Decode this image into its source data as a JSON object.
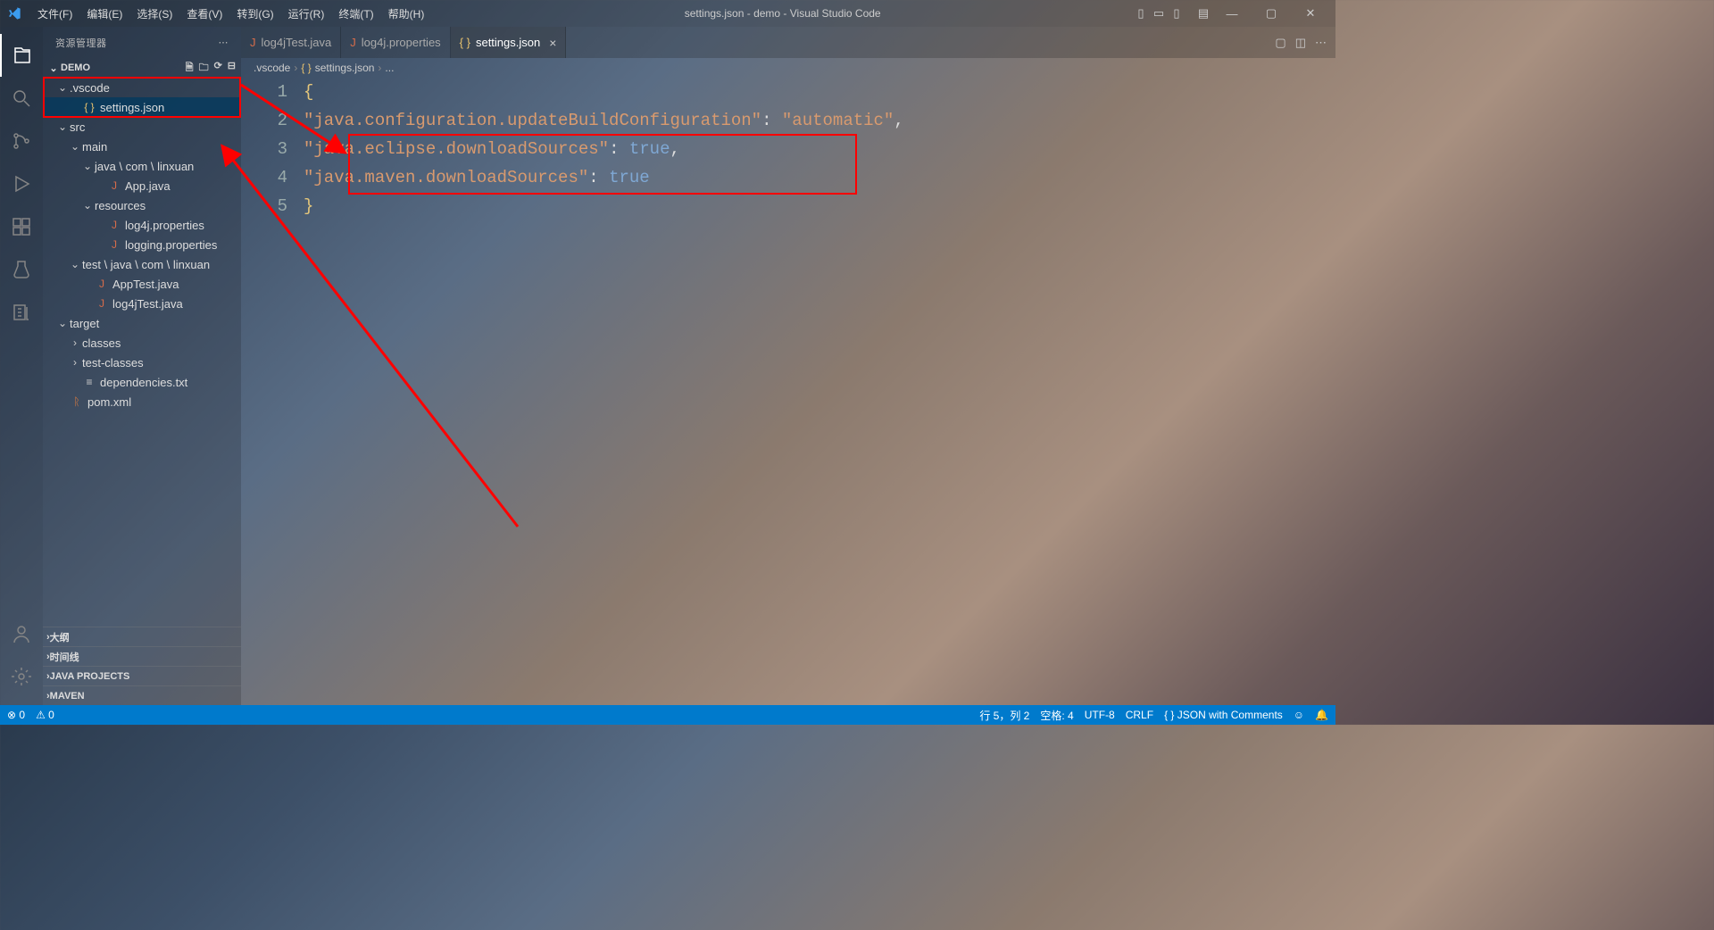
{
  "titlebar": {
    "menu": [
      "文件(F)",
      "编辑(E)",
      "选择(S)",
      "查看(V)",
      "转到(G)",
      "运行(R)",
      "终端(T)",
      "帮助(H)"
    ],
    "title": "settings.json - demo - Visual Studio Code"
  },
  "activitybar": {
    "items": [
      "explorer",
      "search",
      "source-control",
      "run-debug",
      "extensions",
      "testing",
      "references"
    ],
    "bottom": [
      "account",
      "manage"
    ]
  },
  "sidebar": {
    "title": "资源管理器",
    "root": "DEMO",
    "tree": [
      {
        "type": "folder",
        "name": ".vscode",
        "depth": 1,
        "open": true,
        "highlight": true
      },
      {
        "type": "file",
        "name": "settings.json",
        "depth": 2,
        "icon": "braces",
        "selected": true
      },
      {
        "type": "folder",
        "name": "src",
        "depth": 1,
        "open": true
      },
      {
        "type": "folder",
        "name": "main",
        "depth": 2,
        "open": true
      },
      {
        "type": "folder",
        "name": "java \\ com \\ linxuan",
        "depth": 3,
        "open": true
      },
      {
        "type": "file",
        "name": "App.java",
        "depth": 4,
        "icon": "java"
      },
      {
        "type": "folder",
        "name": "resources",
        "depth": 3,
        "open": true
      },
      {
        "type": "file",
        "name": "log4j.properties",
        "depth": 4,
        "icon": "java"
      },
      {
        "type": "file",
        "name": "logging.properties",
        "depth": 4,
        "icon": "java"
      },
      {
        "type": "folder",
        "name": "test \\ java \\ com \\ linxuan",
        "depth": 2,
        "open": true
      },
      {
        "type": "file",
        "name": "AppTest.java",
        "depth": 3,
        "icon": "java"
      },
      {
        "type": "file",
        "name": "log4jTest.java",
        "depth": 3,
        "icon": "java"
      },
      {
        "type": "folder",
        "name": "target",
        "depth": 1,
        "open": true
      },
      {
        "type": "folder",
        "name": "classes",
        "depth": 2,
        "open": false
      },
      {
        "type": "folder",
        "name": "test-classes",
        "depth": 2,
        "open": false
      },
      {
        "type": "file",
        "name": "dependencies.txt",
        "depth": 2,
        "icon": "lines"
      },
      {
        "type": "file",
        "name": "pom.xml",
        "depth": 1,
        "icon": "xmlf"
      }
    ],
    "panels": [
      "大纲",
      "时间线",
      "JAVA PROJECTS",
      "MAVEN"
    ]
  },
  "tabs": [
    {
      "label": "log4jTest.java",
      "icon": "java",
      "active": false
    },
    {
      "label": "log4j.properties",
      "icon": "java",
      "active": false
    },
    {
      "label": "settings.json",
      "icon": "braces",
      "active": true,
      "close": true
    }
  ],
  "breadcrumb": [
    ".vscode",
    "settings.json",
    "..."
  ],
  "code": {
    "lines": [
      {
        "n": 1,
        "tokens": [
          {
            "t": "{",
            "c": "brace"
          }
        ]
      },
      {
        "n": 2,
        "tokens": [
          {
            "t": "    ",
            "c": ""
          },
          {
            "t": "\"java.configuration.updateBuildConfiguration\"",
            "c": "str"
          },
          {
            "t": ": ",
            "c": "punc"
          },
          {
            "t": "\"automatic\"",
            "c": "str"
          },
          {
            "t": ",",
            "c": "punc"
          }
        ]
      },
      {
        "n": 3,
        "tokens": [
          {
            "t": "    ",
            "c": ""
          },
          {
            "t": "\"java.eclipse.downloadSources\"",
            "c": "str"
          },
          {
            "t": ": ",
            "c": "punc"
          },
          {
            "t": "true",
            "c": "bool"
          },
          {
            "t": ",",
            "c": "punc"
          }
        ]
      },
      {
        "n": 4,
        "tokens": [
          {
            "t": "    ",
            "c": ""
          },
          {
            "t": "\"java.maven.downloadSources\"",
            "c": "str"
          },
          {
            "t": ": ",
            "c": "punc"
          },
          {
            "t": "true",
            "c": "bool"
          }
        ]
      },
      {
        "n": 5,
        "tokens": [
          {
            "t": "}",
            "c": "brace"
          }
        ]
      }
    ]
  },
  "status": {
    "left": [
      "⊗ 0",
      "⚠ 0"
    ],
    "right": [
      "行 5，列 2",
      "空格: 4",
      "UTF-8",
      "CRLF",
      "{ } JSON with Comments"
    ]
  }
}
